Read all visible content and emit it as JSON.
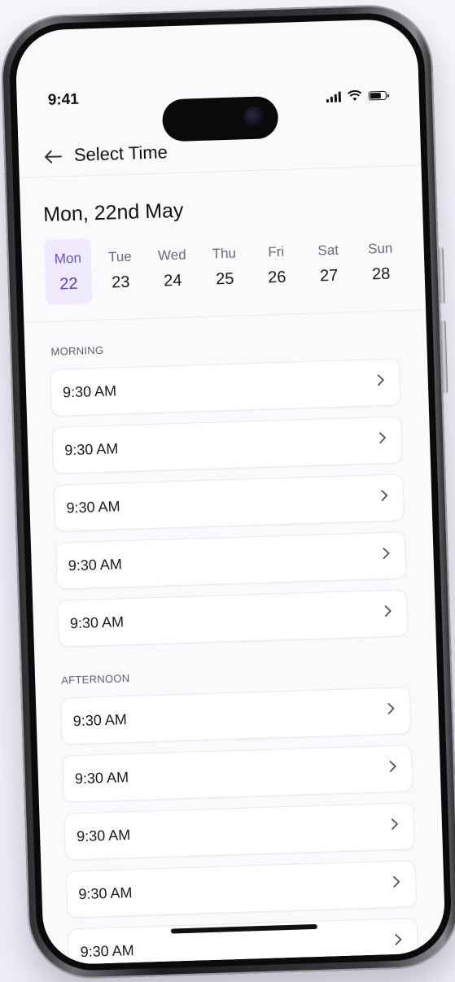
{
  "status": {
    "time": "9:41"
  },
  "header": {
    "title": "Select Time"
  },
  "date_title": "Mon, 22nd May",
  "days": [
    {
      "name": "Mon",
      "num": "22",
      "active": true
    },
    {
      "name": "Tue",
      "num": "23"
    },
    {
      "name": "Wed",
      "num": "24"
    },
    {
      "name": "Thu",
      "num": "25"
    },
    {
      "name": "Fri",
      "num": "26"
    },
    {
      "name": "Sat",
      "num": "27"
    },
    {
      "name": "Sun",
      "num": "28"
    }
  ],
  "sections": [
    {
      "label": "MORNING",
      "slots": [
        "9:30 AM",
        "9:30 AM",
        "9:30 AM",
        "9:30 AM",
        "9:30 AM"
      ]
    },
    {
      "label": "AFTERNOON",
      "slots": [
        "9:30 AM",
        "9:30 AM",
        "9:30 AM",
        "9:30 AM",
        "9:30 AM"
      ]
    }
  ],
  "colors": {
    "accent": "#5b3cc8",
    "accent_bg": "#efeafc"
  }
}
